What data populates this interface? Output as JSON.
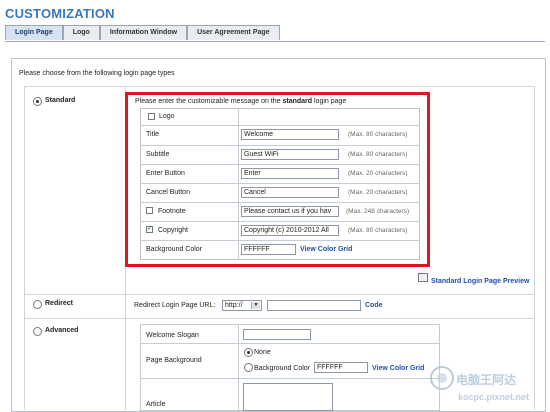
{
  "page": {
    "title": "CUSTOMIZATION",
    "tabs": [
      "Login Page",
      "Logo",
      "Information Window",
      "User Agreement Page"
    ],
    "intro": "Please choose from the following login page types"
  },
  "options": {
    "standard": {
      "label": "Standard",
      "selected": true,
      "heading_prefix": "Please enter the customizable message on the ",
      "heading_bold": "standard",
      "heading_suffix": " login page",
      "rows": {
        "logo": {
          "label": "Logo",
          "checked": false
        },
        "title": {
          "label": "Title",
          "value": "Welcome",
          "max": "(Max. 80 characters)"
        },
        "subtitle": {
          "label": "Subtitle",
          "value": "Guest WiFi",
          "max": "(Max. 80 characters)"
        },
        "enter_button": {
          "label": "Enter Button",
          "value": "Enter",
          "max": "(Max. 20 characters)"
        },
        "cancel_button": {
          "label": "Cancel Button",
          "value": "Cancel",
          "max": "(Max. 20 characters)"
        },
        "footnote": {
          "label": "Footnote",
          "checked": false,
          "value": "Please contact us if you hav",
          "max": "(Max. 248 characters)"
        },
        "copyright": {
          "label": "Copyright",
          "checked": true,
          "value": "Copyright (c) 2010-2012 All",
          "max": "(Max. 80 characters)"
        },
        "background_color": {
          "label": "Background Color",
          "value": "FFFFFF",
          "link": "View Color Grid"
        }
      },
      "preview_link": "Standard Login Page Preview"
    },
    "redirect": {
      "label": "Redirect",
      "selected": false,
      "url_label": "Redirect Login Page URL:",
      "protocol": "http://",
      "code_link": "Code"
    },
    "advanced": {
      "label": "Advanced",
      "selected": false,
      "welcome_slogan": "Welcome Slogan",
      "page_background": "Page Background",
      "bg_none": "None",
      "bg_color_label": "Background Color",
      "bg_color_value": "FFFFFF",
      "color_grid_link": "View Color Grid",
      "article": "Article"
    }
  },
  "watermark": {
    "line1": "电脑王阿达",
    "line2": "kocpc.pixnet.net"
  },
  "colors": {
    "accent": "#3a78b8",
    "highlight_border": "#d71920",
    "link": "#1f4fa8"
  }
}
